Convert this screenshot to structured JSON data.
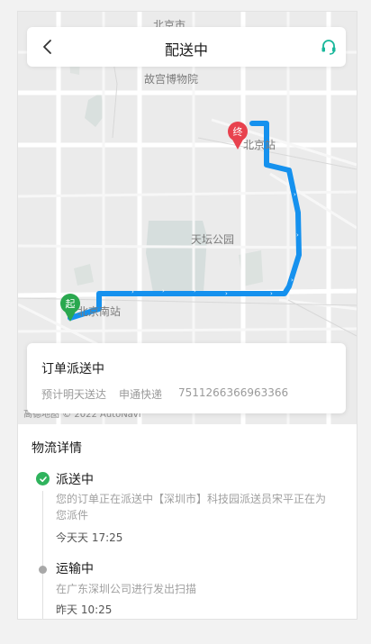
{
  "header": {
    "title": "配送中",
    "back_icon": "chevron-left-icon",
    "support_icon": "headset-icon",
    "accent_color": "#19b79b"
  },
  "map": {
    "labels": {
      "top_cut": "北京市",
      "palace": "故宫博物院",
      "beijing_station": "北京站",
      "temple": "天坛公园",
      "south_station": "北京南站"
    },
    "start_marker": "起",
    "end_marker": "终",
    "start_color": "#2aa84f",
    "end_color": "#e8424e",
    "route_color": "#1591ee",
    "attribution": "高德地图 © 2022 AutoNavi"
  },
  "order": {
    "status": "订单派送中",
    "eta": "预计明天送达",
    "courier": "申通快递",
    "tracking_number": "7511266366963366"
  },
  "logistics": {
    "title": "物流详情",
    "events": [
      {
        "status": "派送中",
        "description": "您的订单正在派送中【深圳市】科技园派送员宋平正在为您派件",
        "time": "今天天 17:25",
        "state_color": "#2fb35d"
      },
      {
        "status": "运输中",
        "description": "在广东深圳公司进行发出扫描",
        "time": "昨天 10:25",
        "state_color": "#a8a8a8"
      }
    ]
  }
}
